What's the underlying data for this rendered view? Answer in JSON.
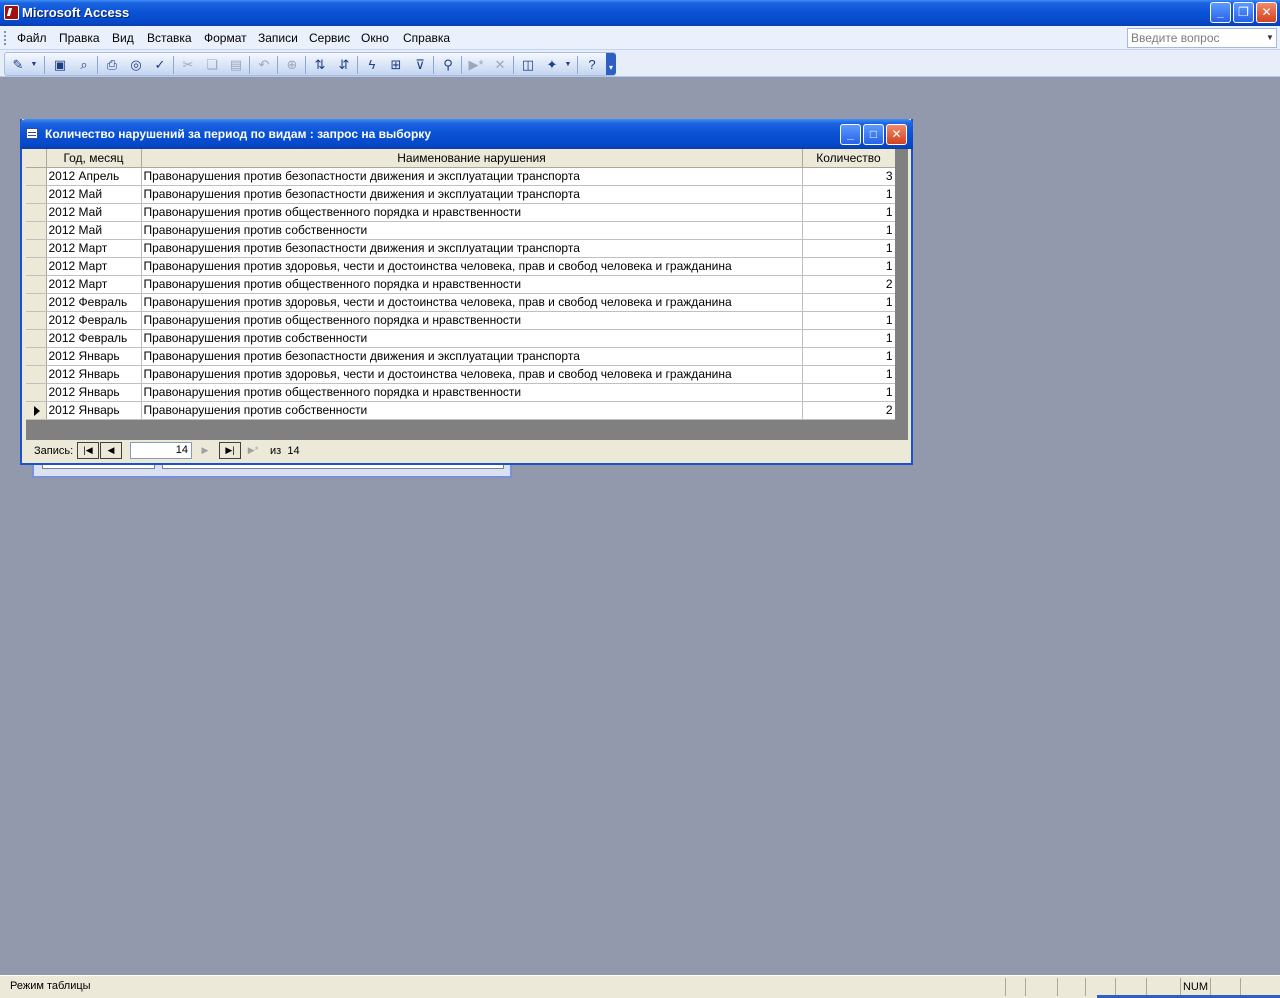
{
  "app": {
    "title": "Microsoft Access"
  },
  "menu": {
    "items": [
      "Файл",
      "Правка",
      "Вид",
      "Вставка",
      "Формат",
      "Записи",
      "Сервис",
      "Окно",
      "Справка"
    ],
    "ask_placeholder": "Введите вопрос"
  },
  "toolbar": {
    "buttons": [
      "view-icon",
      "save-icon",
      "search-file-icon",
      "print-icon",
      "print-preview-icon",
      "spelling-icon",
      "cut-icon",
      "copy-icon",
      "paste-icon",
      "undo-icon",
      "insert-hyperlink-icon",
      "sort-ascending-icon",
      "sort-descending-icon",
      "filter-by-selection-icon",
      "filter-by-form-icon",
      "apply-filter-icon",
      "find-icon",
      "new-record-icon",
      "delete-record-icon",
      "database-window-icon",
      "new-object-icon",
      "help-icon"
    ]
  },
  "window": {
    "title": "Количество нарушений за период по видам : запрос на выборку"
  },
  "grid": {
    "columns": [
      "Год, месяц",
      "Наименование нарушения",
      "Количество"
    ],
    "rows": [
      {
        "period": "2012 Апрель",
        "name": "Правонарушения против безопастности движения и эксплуатации транспорта",
        "count": "3"
      },
      {
        "period": "2012 Май",
        "name": "Правонарушения против безопастности движения и эксплуатации транспорта",
        "count": "1"
      },
      {
        "period": "2012 Май",
        "name": "Правонарушения против общественного порядка и нравственности",
        "count": "1"
      },
      {
        "period": "2012 Май",
        "name": "Правонарушения против собственности",
        "count": "1"
      },
      {
        "period": "2012 Март",
        "name": "Правонарушения против безопастности движения и эксплуатации транспорта",
        "count": "1"
      },
      {
        "period": "2012 Март",
        "name": "Правонарушения против здоровья, чести и достоинства человека, прав и свобод человека и гражданина",
        "count": "1"
      },
      {
        "period": "2012 Март",
        "name": "Правонарушения против общественного порядка и нравственности",
        "count": "2"
      },
      {
        "period": "2012 Февраль",
        "name": "Правонарушения против здоровья, чести и достоинства человека, прав и свобод человека и гражданина",
        "count": "1"
      },
      {
        "period": "2012 Февраль",
        "name": "Правонарушения против общественного порядка и нравственности",
        "count": "1"
      },
      {
        "period": "2012 Февраль",
        "name": "Правонарушения против собственности",
        "count": "1"
      },
      {
        "period": "2012 Январь",
        "name": "Правонарушения против безопастности движения и эксплуатации транспорта",
        "count": "1"
      },
      {
        "period": "2012 Январь",
        "name": "Правонарушения против здоровья, чести и достоинства человека, прав и свобод человека и гражданина",
        "count": "1"
      },
      {
        "period": "2012 Январь",
        "name": "Правонарушения против общественного порядка и нравственности",
        "count": "1"
      },
      {
        "period": "2012 Январь",
        "name": "Правонарушения против собственности",
        "count": "2"
      }
    ],
    "current_row": 13
  },
  "nav": {
    "label": "Запись:",
    "current": "14",
    "of_label": "из",
    "total": "14"
  },
  "status": {
    "text": "Режим таблицы",
    "num": "NUM"
  }
}
